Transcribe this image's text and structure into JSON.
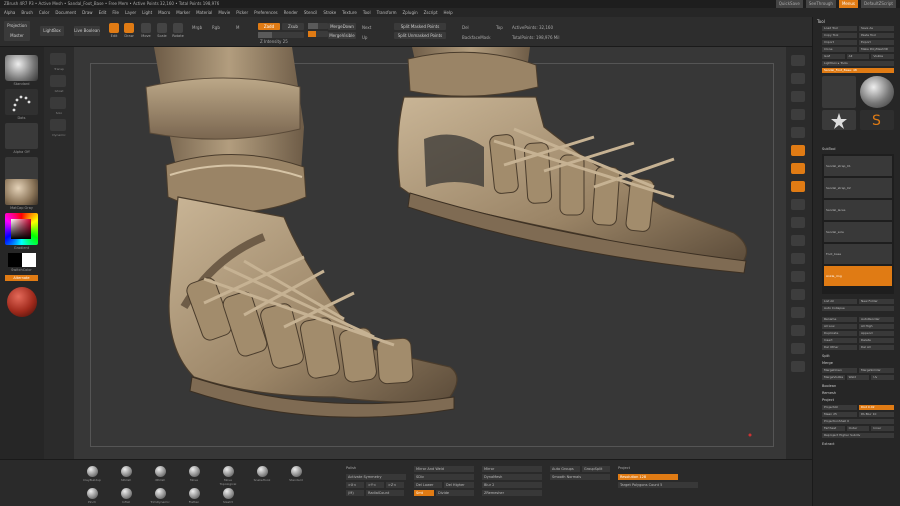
{
  "title_bar": {
    "text": "ZBrush 4R7 P3 • Active Mesh • Sandal_Foot_Base • Free Mem • Active Points 32,160 • Total Points 198,976",
    "right_buttons": [
      "QuickSave",
      "SeeThrough",
      "Menus",
      "DefaultZScript"
    ]
  },
  "menu": [
    "Alpha",
    "Brush",
    "Color",
    "Document",
    "Draw",
    "Edit",
    "File",
    "Layer",
    "Light",
    "Macro",
    "Marker",
    "Material",
    "Movie",
    "Picker",
    "Preferences",
    "Render",
    "Stencil",
    "Stroke",
    "Texture",
    "Tool",
    "Transform",
    "Zplugin",
    "Zscript",
    "Help"
  ],
  "toolbar": {
    "projection_master": "Projection Master",
    "lightbox": "LightBox",
    "live_boolean": "Live Boolean",
    "edit": "Edit",
    "draw": "Draw",
    "move": "Move",
    "scale": "Scale",
    "rotate": "Rotate",
    "mrgb": "Mrgb",
    "rgb": "Rgb",
    "m": "M",
    "zadd": "Zadd",
    "zsub": "Zsub",
    "focal_shift": "Focal Shift 0",
    "z_intensity": "Z Intensity 25",
    "draw_size": "Draw Size 64",
    "dynamic": "Dynamic",
    "merge_down": "MergeDown",
    "merge_visible": "MergeVisible",
    "next": "Next",
    "up": "Up",
    "split_masked": "Split Masked Points",
    "split_unmasked": "Split Unmasked Points",
    "del": "Del",
    "backface_mask": "BackfaceMask",
    "active_points": "ActivePoints: 32,160",
    "total_points": "TotalPoints: 198,976 Mil",
    "top": "Top"
  },
  "left_shelf": {
    "brush": "Standard",
    "stroke": "Dots",
    "alpha": "Alpha Off",
    "texture": "Texture Off",
    "material": "MatCap Gray",
    "gradient": "Gradient",
    "switch_color": "SwitchColor",
    "alternate": "Alternate"
  },
  "left_col": [
    "Transp",
    "Ghost",
    "Solo",
    "Dynamic",
    "Persp",
    "Floor",
    "Local",
    "Frame"
  ],
  "right_panel": {
    "header": "Tool",
    "rows": [
      [
        "Load Tool",
        "Save As"
      ],
      [
        "Copy Tool",
        "Paste Tool"
      ],
      [
        "Import",
        "Export"
      ],
      [
        "Clone",
        "Make PolyMesh3D"
      ],
      [
        "GoZ",
        "All",
        "Visible"
      ],
      [
        "Lightbox ▸ Tools"
      ]
    ],
    "current_tool": "Sandal_Foot_Base: 48",
    "tools": [
      "SimpleBrush",
      "PolyMesh3D",
      "ZSphere",
      "Sandal_Foot"
    ],
    "subtool_header": "SubTool",
    "subtools": [
      "Sandal_strap_01",
      "Sandal_strap_02",
      "Sandal_laces",
      "Sandal_sole",
      "Foot_base",
      "Ankle_ring"
    ],
    "list_all": "List All",
    "new_folder": "New Folder",
    "auto_collapse": "Auto Collapse",
    "actions": [
      "Rename",
      "AutoReorder",
      "All Low",
      "All High",
      "Duplicate",
      "Append",
      "Insert",
      "Delete",
      "Del Other",
      "Del All",
      "Split",
      "Merge"
    ],
    "merge_down": "MergeDown",
    "merge_similar": "MergeSimilar",
    "merge_visible": "MergeVisible",
    "weld": "Weld",
    "uv": "Uv",
    "boolean": "Boolean",
    "remesh": "Remesh",
    "project": "Project",
    "project_all": "ProjectAll",
    "dist": "Dist 0.02",
    "mean": "Mean 25",
    "pa_blur": "PA Blur 10",
    "projection_shell": "ProjectionShell 0",
    "farthest": "Farthest",
    "outer": "Outer",
    "inner": "Inner",
    "reproject": "Reproject Higher Subdiv",
    "extract": "Extract"
  },
  "bottom": {
    "brushes": [
      "ClayBuildup",
      "hPolish",
      "dPolish",
      "Move",
      "Move Topological",
      "SnakeHook",
      "Standard",
      "Pinch",
      "Inflat",
      "TrimDynamic",
      "Flatten",
      "Slash3"
    ],
    "polish": "Polish",
    "activate_symmetry": "Activate Symmetry",
    "x": ">X<",
    "y": ">Y<",
    "z": ">Z<",
    "m": "(M)",
    "radial_count": "RadialCount",
    "mirror_and_weld": "Mirror And Weld",
    "mirror": "Mirror",
    "dynamesh": "DynaMesh",
    "auto_groups": "Auto Groups",
    "group_split": "GroupSplit",
    "blur": "Blur 2",
    "project": "Project",
    "resolution": "Resolution 128",
    "sdiv": "SDiv",
    "del_lower": "Del Lower",
    "del_higher": "Del Higher",
    "smt": "Smt",
    "divide": "Divide",
    "zremesher": "ZRemesher",
    "target_polygons": "Target Polygons Count 5",
    "smooth_normals": "Smooth Normals"
  },
  "colors": {
    "accent": "#e07b14",
    "viewport_bg": "#373737",
    "panel_bg": "#262626",
    "sandal": "#a08a6c",
    "sandal_shadow": "#6e5d47",
    "sandal_highlight": "#c8b394"
  }
}
